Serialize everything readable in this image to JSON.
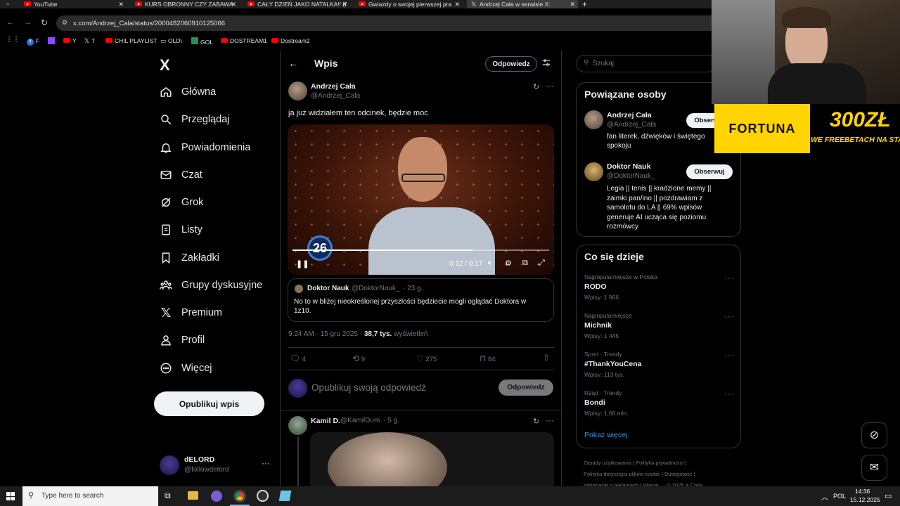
{
  "browser": {
    "tabs": [
      {
        "label": "YouTube"
      },
      {
        "label": "KURS OBRONNY CZY ZABAWA"
      },
      {
        "label": "CAŁY DZIEŃ JAKO NATALKA!! (f"
      },
      {
        "label": "Gwiazdy o swojej pierwszej pra"
      },
      {
        "label": "Andrzej Cała w serwisie X:"
      }
    ],
    "new_tab": "+",
    "url": "x.com/Andrzej_Cala/status/2000482060910125066",
    "bookmarks": [
      "F",
      "Y",
      "T",
      "CHIL PLAYLIST",
      "OLD\\",
      "GOL",
      "DOSTREAM1",
      "Dostream2"
    ]
  },
  "nav": {
    "logo": "X",
    "items": [
      "Główna",
      "Przeglądaj",
      "Powiadomienia",
      "Czat",
      "Grok",
      "Listy",
      "Zakładki",
      "Grupy dyskusyjne",
      "Premium",
      "Profil",
      "Więcej"
    ],
    "post_button": "Opublikuj wpis",
    "account": {
      "name": "dELORD",
      "handle": "@followdelord"
    }
  },
  "header": {
    "title": "Wpis",
    "reply_button": "Odpowiedz"
  },
  "tweet": {
    "author": "Andrzej Cała",
    "handle": "@Andrzej_Cala",
    "text": "ja już widziałem ten odcinek, będzie moc",
    "video": {
      "badge": "26",
      "time": "0:12 / 0:17",
      "progress": 0.7
    },
    "quote": {
      "author": "Doktor Nauk",
      "handle": "@DoktorNauk_",
      "age": "· 23 g.",
      "text": "No to w bliżej nieokreślonej przyszłości będziecie mogli oglądać Doktora w 1z10."
    },
    "meta_time": "9:24 AM · 15 gru 2025 ·",
    "meta_views": "38,7 tys.",
    "meta_views_label": "wyświetleń",
    "stats": {
      "replies": "4",
      "reposts": "9",
      "likes": "275",
      "bookmarks": "84"
    }
  },
  "compose": {
    "placeholder": "Opublikuj swoją odpowiedź",
    "button": "Odpowiedz"
  },
  "reply": {
    "author": "Kamil D.",
    "handle": "@KamilDum",
    "age": "· 5 g."
  },
  "search": {
    "placeholder": "Szukaj"
  },
  "related": {
    "title": "Powiązane osoby",
    "people": [
      {
        "name": "Andrzej Cała",
        "handle": "@Andrzej_Cala",
        "bio": "fan literek, dźwięków i świętego spokoju",
        "button": "Obserwuj"
      },
      {
        "name": "Doktor Nauk",
        "handle": "@DoktorNauk_",
        "bio": "Legia || tenis || kradzione memy || zaimki pan/ino || pozdrawiam z samolotu do LA || 69% wpisów generuje AI ucząca się poziomu rozmówcy",
        "button": "Obserwuj"
      }
    ]
  },
  "trends": {
    "title": "Co się dzieje",
    "items": [
      {
        "cat": "Najpopularniejsze w Polska",
        "name": "RODO",
        "count": "Wpisy: 1 966"
      },
      {
        "cat": "Najpopularniejsze",
        "name": "Michnik",
        "count": "Wpisy: 1 445"
      },
      {
        "cat": "Sport · Trendy",
        "name": "#ThankYouCena",
        "count": "Wpisy: 113 tys."
      },
      {
        "cat": "Rząd · Trendy",
        "name": "Bondi",
        "count": "Wpisy: 1,66 mln"
      }
    ],
    "show_more": "Pokaż więcej"
  },
  "footer": {
    "links": [
      "Zasady użytkowania",
      "Polityka prywatności",
      "Polityka dotycząca plików cookie",
      "Dostępność",
      "Informacje o reklamach",
      "Więcej ···",
      "© 2025 X Corp."
    ]
  },
  "overlay": {
    "brand": "FORTUNA",
    "promo_big": "300ZŁ",
    "promo_small": "WE FREEBETACH NA START"
  },
  "taskbar": {
    "search": "Type here to search",
    "lang": "POL",
    "time": "14:36",
    "date": "15.12.2025"
  },
  "colors": {
    "bg": "#000000",
    "accent": "#1d9bf0",
    "border": "#2f3336",
    "fortuna": "#ffd400"
  }
}
